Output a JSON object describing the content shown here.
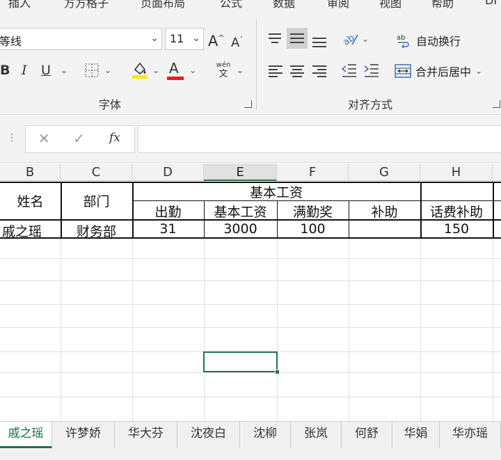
{
  "ribbon_tabs": [
    "插入",
    "方方格子",
    "页面布局",
    "公式",
    "数据",
    "审阅",
    "视图",
    "帮助",
    "DI"
  ],
  "font": {
    "name": "等线",
    "size": "11",
    "grow_label": "A",
    "shrink_label": "A",
    "bold": "B",
    "italic": "I",
    "underline": "U",
    "font_color_letter": "A",
    "phonetic_top": "wén",
    "phonetic_bottom": "文",
    "group_label": "字体",
    "font_color": "#e02020",
    "highlight_color": "#ffe800"
  },
  "alignment": {
    "wrap_text": "自动换行",
    "merge_center": "合并后居中",
    "group_label": "对齐方式"
  },
  "formula_bar": {
    "cancel": "✕",
    "enter": "✓",
    "fx": "fx",
    "value": ""
  },
  "columns": [
    "B",
    "C",
    "D",
    "E",
    "F",
    "G",
    "H"
  ],
  "selected_column": "E",
  "table": {
    "name_header": "姓名",
    "dept_header": "部门",
    "group_header": "基本工资",
    "sub_headers": [
      "出勤",
      "基本工资",
      "满勤奖",
      "补助",
      "话费补助"
    ],
    "row": {
      "name": "戚之瑶",
      "dept": "财务部",
      "attendance": "31",
      "base_salary": "3000",
      "full_attendance_bonus": "100",
      "subsidy": "",
      "phone_subsidy": "150"
    }
  },
  "sheet_tabs": [
    "戚之瑶",
    "许梦娇",
    "华大芬",
    "沈夜白",
    "沈柳",
    "张岚",
    "何舒",
    "华娟",
    "华亦瑶"
  ],
  "active_sheet": "戚之瑶",
  "accent_color": "#217346"
}
